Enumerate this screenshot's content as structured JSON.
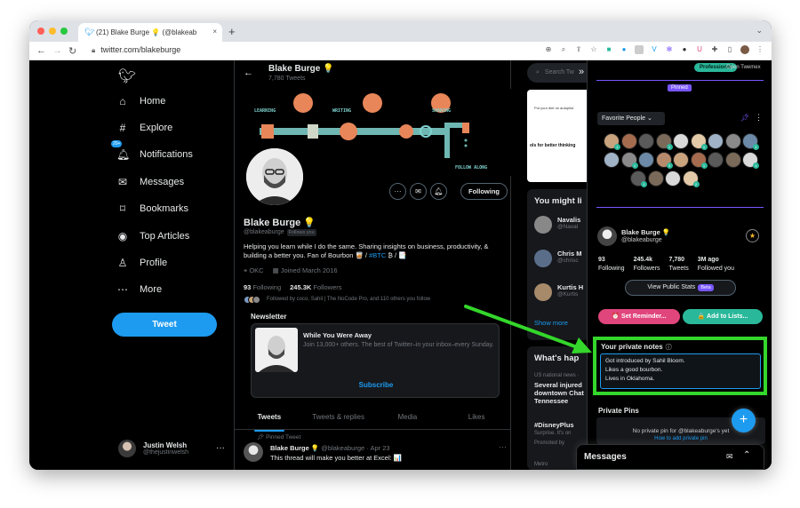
{
  "browser": {
    "tab_title": "(21) Blake Burge 💡 (@blakeab",
    "tab_close": "×",
    "new_tab": "+",
    "url": "twitter.com/blakeburge"
  },
  "sidebar": {
    "items": [
      {
        "label": "Home",
        "icon": "home-icon",
        "glyph": "⌂"
      },
      {
        "label": "Explore",
        "icon": "hashtag-icon",
        "glyph": "#"
      },
      {
        "label": "Notifications",
        "icon": "bell-icon",
        "glyph": "🔔︎",
        "badge": "20+"
      },
      {
        "label": "Messages",
        "icon": "envelope-icon",
        "glyph": "✉"
      },
      {
        "label": "Bookmarks",
        "icon": "bookmark-icon",
        "glyph": "⌑"
      },
      {
        "label": "Top Articles",
        "icon": "flame-icon",
        "glyph": "◉"
      },
      {
        "label": "Profile",
        "icon": "person-icon",
        "glyph": "♙"
      },
      {
        "label": "More",
        "icon": "more-circle-icon",
        "glyph": "⋯"
      }
    ],
    "tweet_button": "Tweet",
    "account": {
      "name": "Justin Welsh",
      "handle": "@thejustinwelsh",
      "more": "···"
    }
  },
  "profile_header": {
    "name": "Blake Burge 💡",
    "tweets_count": "7,780 Tweets"
  },
  "banner": {
    "labels": [
      "LEARNING",
      "WRITING",
      "SHARING",
      "FOLLOW ALONG"
    ]
  },
  "profile": {
    "name": "Blake Burge 💡",
    "handle": "@blakeaburge",
    "follows_you": "Follows you",
    "following_button": "Following",
    "bio_line1": "Helping you learn while I do the same. Sharing insights on business, productivity, &",
    "bio_line2_pre": "building a better you. Fan of Bourbon 🥃 /",
    "bio_hashtag": "#BTC",
    "bio_line2_post": "₿ / 📑",
    "location": "OKC",
    "joined": "Joined March 2016",
    "following_count": "93",
    "following_label": "Following",
    "followers_count": "245.3K",
    "followers_label": "Followers",
    "followed_by": "Followed by coco, Sahil | The NoCode Pro, and 110 others you follow"
  },
  "newsletter": {
    "section_title": "Newsletter",
    "card_title": "While You Were Away",
    "card_text": "Join 13,000+ others. The best of Twitter–in your inbox–every Sunday.",
    "subscribe": "Subscribe"
  },
  "tabs": [
    {
      "label": "Tweets",
      "active": true
    },
    {
      "label": "Tweets & replies",
      "active": false
    },
    {
      "label": "Media",
      "active": false
    },
    {
      "label": "Likes",
      "active": false
    }
  ],
  "pinned_tweet": {
    "label": "Pinned Tweet",
    "name": "Blake Burge 💡",
    "meta": "@blakeaburge · Apr 23",
    "text": "This thread will make you better at Excel: 📊"
  },
  "right": {
    "search_placeholder": "Search Tw",
    "promo_text1": "Put your diet on autopilot",
    "promo_text2": "ols for better thinking",
    "you_might_like": "You might li",
    "suggestions": [
      {
        "name": "Navalis",
        "handle": "@Naval"
      },
      {
        "name": "Chris M",
        "handle": "@chrisc"
      },
      {
        "name": "Kurtis H",
        "handle": "@Kurtis"
      }
    ],
    "show_more": "Show more",
    "whats_happening": "What's hap",
    "trends": [
      {
        "sub": "US national news ·",
        "head": "Several injured downtown Chat Tennessee"
      },
      {
        "sub": "",
        "head": "#DisneyPlus"
      },
      {
        "sub": "Surprise. It's on",
        "head": ""
      },
      {
        "sub": "Promoted by",
        "head": ""
      },
      {
        "sub": "Metro",
        "head": ""
      }
    ]
  },
  "twemex": {
    "professional_chip": "Professional",
    "open_label": "Open Twemex",
    "pinned_tag": "Pinned",
    "favorite_people": "Favorite People",
    "fav_badges": [
      "1",
      "",
      "",
      "1",
      "",
      "1",
      "",
      "",
      "1",
      "",
      "1",
      "",
      "3",
      "",
      "1",
      "",
      "",
      "1",
      "1",
      "",
      "",
      "2",
      "",
      "1",
      "",
      "1",
      ""
    ],
    "profile": {
      "name": "Blake Burge 💡",
      "handle": "@blakeaburge"
    },
    "stats": [
      {
        "value": "93",
        "label": "Following"
      },
      {
        "value": "245.4k",
        "label": "Followers"
      },
      {
        "value": "7,780",
        "label": "Tweets"
      },
      {
        "value": "3M ago",
        "label": "Followed you"
      }
    ],
    "view_stats_button": "View Public Stats",
    "beta": "Beta",
    "set_reminder": "⏰ Set Reminder...",
    "add_to_lists": "🔒 Add to Lists...",
    "notes_title": "Your private notes",
    "notes": [
      "Got introduced by Sahil Bloom.",
      "Likes a good bourbon.",
      "Lives in Oklahoma."
    ],
    "private_pins_title": "Private Pins",
    "no_pins": "No private pin for @blakeaburge's yet",
    "how_to_pin": "How to add private pin"
  },
  "messages_dock": {
    "title": "Messages"
  },
  "colors": {
    "accent": "#1d9bf0",
    "highlight_green": "#34d62b",
    "purple": "#7856ff",
    "teal": "#2ab89a",
    "pink": "#e0457b"
  }
}
